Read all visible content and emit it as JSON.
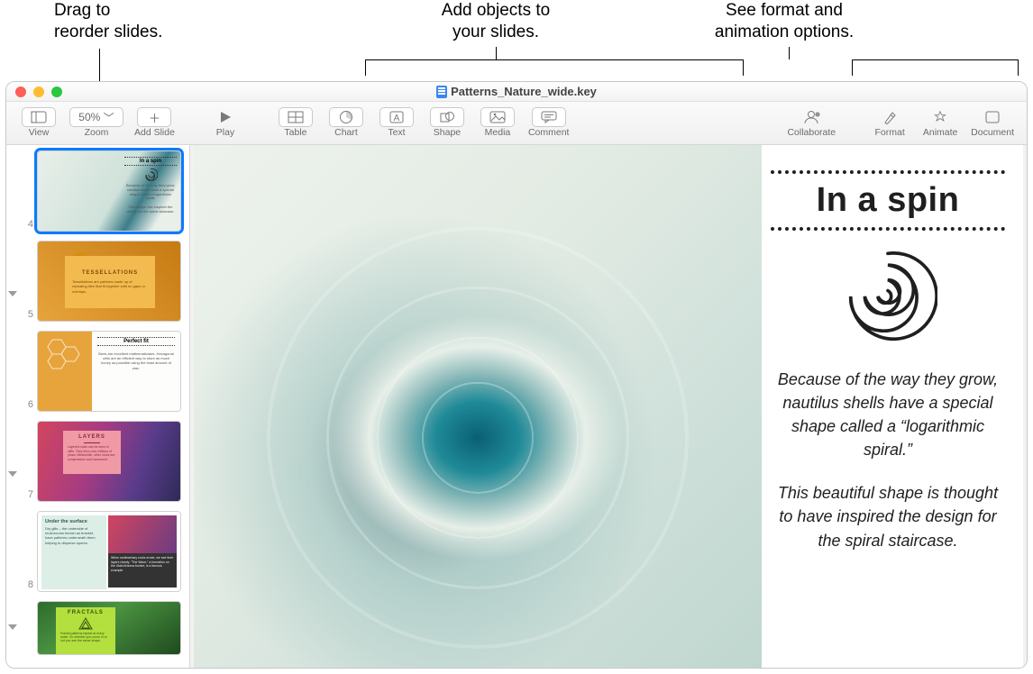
{
  "callouts": {
    "reorder": "Drag to\nreorder slides.",
    "add_objects": "Add objects to\nyour slides.",
    "format_anim": "See format and\nanimation options."
  },
  "window": {
    "title": "Patterns_Nature_wide.key"
  },
  "toolbar": {
    "view": "View",
    "zoom_value": "50%",
    "zoom_label": "Zoom",
    "add_slide": "Add Slide",
    "play": "Play",
    "table": "Table",
    "chart": "Chart",
    "text": "Text",
    "shape": "Shape",
    "media": "Media",
    "comment": "Comment",
    "collaborate": "Collaborate",
    "format": "Format",
    "animate": "Animate",
    "document": "Document"
  },
  "navigator": {
    "slides": [
      {
        "num": "4",
        "selected": true,
        "disclosure": false,
        "label": "In a spin"
      },
      {
        "num": "5",
        "selected": false,
        "disclosure": true,
        "label": "TESSELLATIONS"
      },
      {
        "num": "6",
        "selected": false,
        "disclosure": false,
        "label": "Perfect fit"
      },
      {
        "num": "7",
        "selected": false,
        "disclosure": true,
        "label": "LAYERS"
      },
      {
        "num": "8",
        "selected": false,
        "disclosure": false,
        "label": "Under the surface"
      },
      {
        "num": "",
        "selected": false,
        "disclosure": true,
        "label": "FRACTALS"
      }
    ]
  },
  "slide": {
    "title": "In a spin",
    "para1": "Because of the way they grow, nautilus shells have a special shape called a “logarithmic spiral.”",
    "para2": "This beautiful shape is thought to have inspired the design for the spiral staircase."
  }
}
